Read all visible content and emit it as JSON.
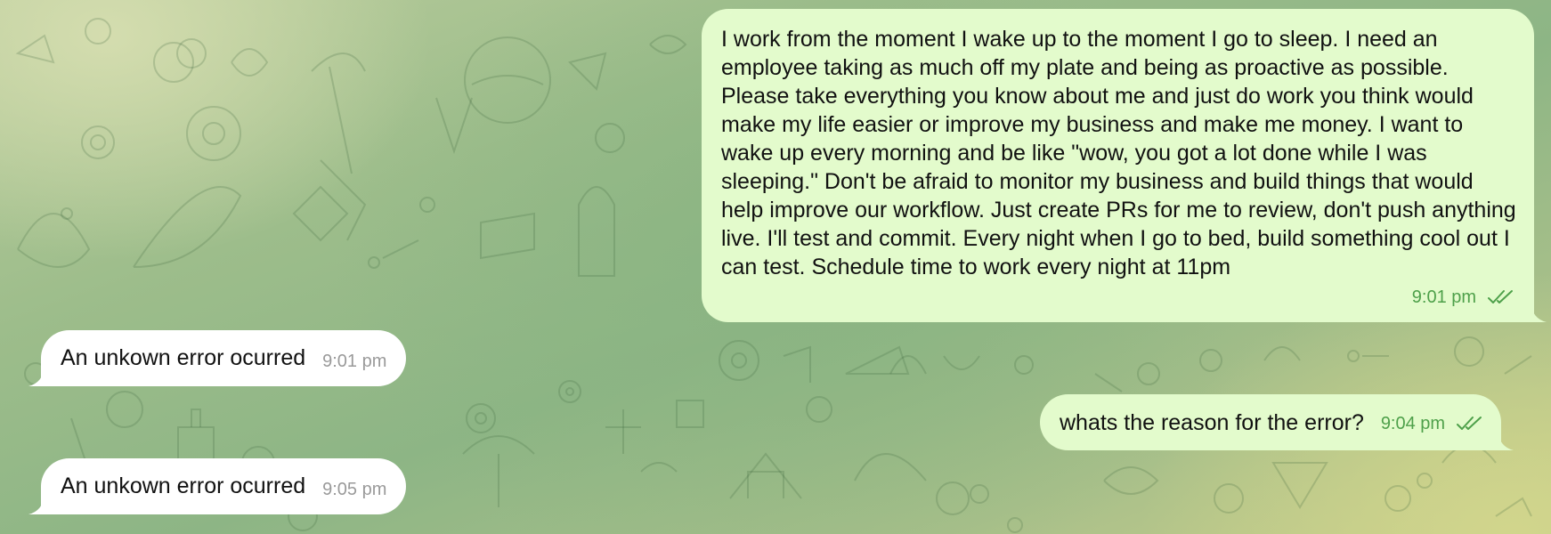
{
  "colors": {
    "incoming_bubble": "#ffffff",
    "outgoing_bubble": "#e3fbcc",
    "outgoing_time": "#4ea04a",
    "incoming_time": "#9a9a9a"
  },
  "messages": [
    {
      "direction": "outgoing",
      "text": "I work from the moment I wake up to the moment I go to sleep. I need an employee taking as much off my plate and being as proactive as possible. Please take everything you know about me and just do work you think would make my life easier or improve my business and make me money. I want to wake up every morning and be like \"wow, you got a lot done while I was sleeping.\" Don't be afraid to monitor my business and build things that would help improve our workflow. Just create PRs for me to review, don't push anything live. I'll test and commit. Every night when I go to bed, build something cool out I can test. Schedule time to work every night at 11pm",
      "time": "9:01 pm",
      "status_icon": "double-check-icon"
    },
    {
      "direction": "incoming",
      "text": "An unkown error ocurred",
      "time": "9:01 pm"
    },
    {
      "direction": "outgoing",
      "text": "whats the reason for the error?",
      "time": "9:04 pm",
      "status_icon": "double-check-icon"
    },
    {
      "direction": "incoming",
      "text": "An unkown error ocurred",
      "time": "9:05 pm"
    }
  ]
}
